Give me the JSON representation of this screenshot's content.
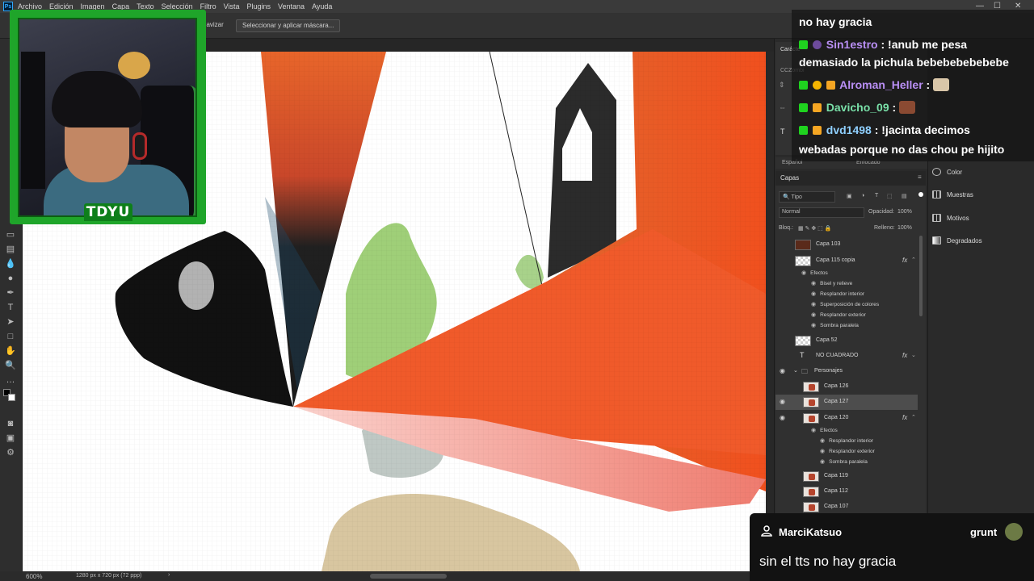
{
  "menubar": {
    "logo": "Ps",
    "items": [
      "Archivo",
      "Edición",
      "Imagen",
      "Capa",
      "Texto",
      "Selección",
      "Filtro",
      "Vista",
      "Plugins",
      "Ventana",
      "Ayuda"
    ]
  },
  "options_bar": {
    "button_suavizar": "uavizar",
    "button_mask": "Seleccionar y aplicar máscara..."
  },
  "status_bar": {
    "zoom": "600%",
    "dimensions": "1280 px x 720 px (72 ppp)",
    "arrow": "›"
  },
  "character_panel": {
    "tab_label": "Carácte",
    "font_field": "CCZombi",
    "language": "Español",
    "antialias": "Enfocado"
  },
  "layers_panel": {
    "tab_label": "Capas",
    "filter_kind": "Tipo",
    "blend_mode": "Normal",
    "opacity_label": "Opacidad:",
    "opacity_value": "100%",
    "lock_label": "Bloq.:",
    "fill_label": "Relleno:",
    "fill_value": "100%",
    "layers": [
      {
        "name": "Capa 103"
      },
      {
        "name": "Capa 115 copia",
        "fx": "fx"
      },
      {
        "name": "Efectos"
      },
      {
        "name": "Bisel y relieve"
      },
      {
        "name": "Resplandor interior"
      },
      {
        "name": "Superposición de colores"
      },
      {
        "name": "Resplandor exterior"
      },
      {
        "name": "Sombra paralela"
      },
      {
        "name": "Capa 52"
      },
      {
        "name": "NO CUADRADO",
        "fx": "fx"
      },
      {
        "name": "Personajes"
      },
      {
        "name": "Capa 126"
      },
      {
        "name": "Capa 127"
      },
      {
        "name": "Capa 120",
        "fx": "fx"
      },
      {
        "name": "Efectos"
      },
      {
        "name": "Resplandor interior"
      },
      {
        "name": "Resplandor exterior"
      },
      {
        "name": "Sombra paralela"
      },
      {
        "name": "Capa 119"
      },
      {
        "name": "Capa 112"
      },
      {
        "name": "Capa 107"
      }
    ]
  },
  "dock": {
    "items": [
      "Color",
      "Muestras",
      "Motivos",
      "Degradados"
    ]
  },
  "webcam": {
    "label": "TDYU"
  },
  "chat": {
    "lines": [
      {
        "text": "no hay gracia"
      },
      {
        "user": "Sin1estro",
        "user_color": "#b98ff5",
        "message": " : !anub me pesa"
      },
      {
        "text": "demasiado la pichula bebebebebebebe"
      },
      {
        "user": "Alroman_Heller",
        "user_color": "#b98ff5",
        "message": " :"
      },
      {
        "user": "Davicho_09",
        "user_color": "#79e0a8",
        "message": " :"
      },
      {
        "user": "dvd1498",
        "user_color": "#8fd0ff",
        "message": " : !jacinta decimos"
      },
      {
        "text": "webadas porque no das chou pe hijito"
      }
    ]
  },
  "tts": {
    "user": "MarciKatsuo",
    "voice": "grunt",
    "message": "sin el tts no hay gracia"
  },
  "colors": {
    "accent_green": "#1fa52a",
    "canvas_orange": "#f05a2a",
    "canvas_pink": "#f3a59a"
  }
}
